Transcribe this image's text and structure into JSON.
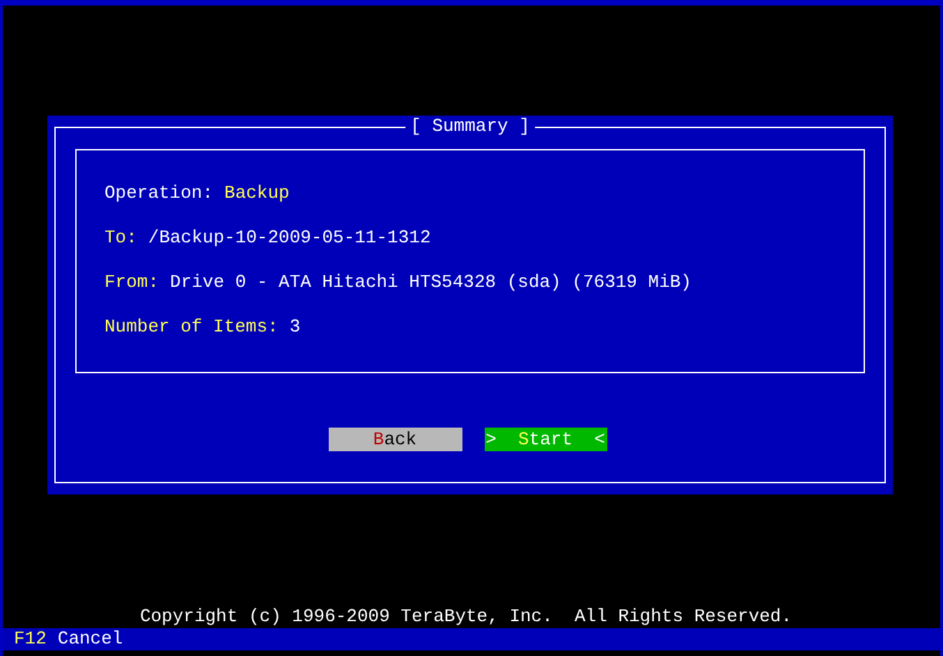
{
  "dialog": {
    "title": "[ Summary ]",
    "fields": [
      {
        "label": "Operation:",
        "value": "Backup",
        "kind": "value_highlight"
      },
      {
        "label": "To:",
        "value": "/Backup-10-2009-05-11-1312",
        "kind": "label_highlight"
      },
      {
        "label": "From:",
        "value": "Drive 0 - ATA Hitachi HTS54328 (sda) (76319 MiB)",
        "kind": "label_highlight"
      },
      {
        "label": "Number of Items:",
        "value": "3",
        "kind": "label_highlight"
      }
    ],
    "buttons": [
      {
        "hotkey": "B",
        "rest": "ack",
        "selected": false
      },
      {
        "hotkey": "S",
        "rest": "tart",
        "selected": true,
        "left_marker": ">",
        "right_marker": "<"
      }
    ]
  },
  "copyright": "Copyright (c) 1996-2009 TeraByte, Inc.  All Rights Reserved.",
  "status_bar": {
    "key": "F12",
    "action": "Cancel"
  }
}
